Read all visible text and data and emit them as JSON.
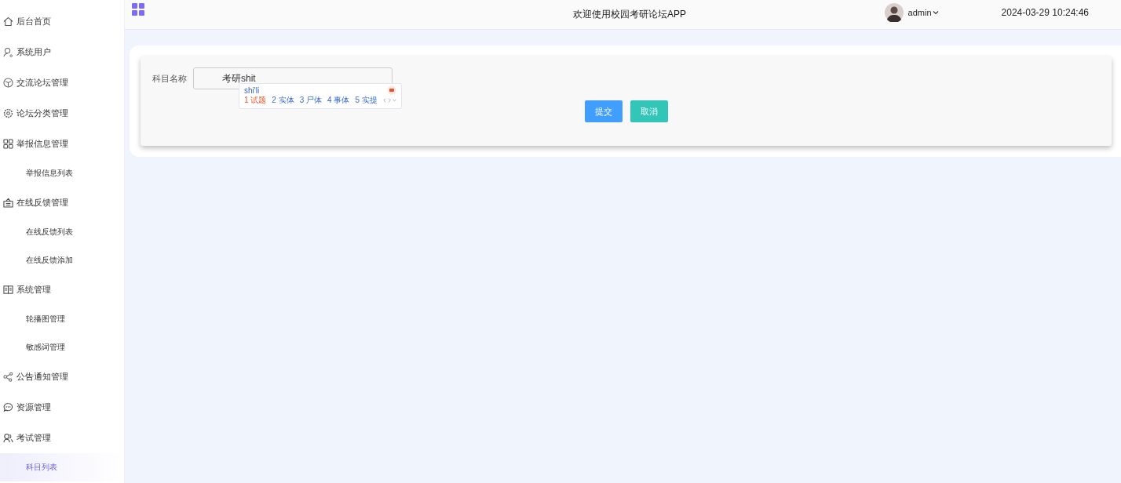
{
  "sidebar": {
    "items": [
      {
        "label": "后台首页",
        "selected": false
      },
      {
        "label": "系统用户",
        "selected": false
      },
      {
        "label": "交流论坛管理",
        "selected": false
      },
      {
        "label": "论坛分类管理",
        "selected": false
      },
      {
        "label": "举报信息管理",
        "selected": false,
        "children": [
          {
            "label": "举报信息列表",
            "selected": false
          }
        ]
      },
      {
        "label": "在线反馈管理",
        "selected": false,
        "children": [
          {
            "label": "在线反馈列表",
            "selected": false
          },
          {
            "label": "在线反馈添加",
            "selected": false
          }
        ]
      },
      {
        "label": "系统管理",
        "selected": false,
        "children": [
          {
            "label": "轮播图管理",
            "selected": false
          },
          {
            "label": "敏感词管理",
            "selected": false
          }
        ]
      },
      {
        "label": "公告通知管理",
        "selected": false
      },
      {
        "label": "资源管理",
        "selected": false
      },
      {
        "label": "考试管理",
        "selected": false,
        "children": [
          {
            "label": "科目列表",
            "selected": true
          }
        ]
      }
    ]
  },
  "header": {
    "title": "欢迎使用校园考研论坛APP",
    "user": "admin",
    "datetime": "2024-03-29 10:24:46"
  },
  "form": {
    "label": "科目名称",
    "value": "考研shit",
    "buttons": [
      {
        "label": "提交",
        "kind": "primary"
      },
      {
        "label": "取消",
        "kind": "cancel"
      }
    ]
  },
  "ime_popup": {
    "composition": "shi'li",
    "candidates": [
      {
        "label": "1 试题",
        "selected": true
      },
      {
        "label": "2 实体",
        "selected": false
      },
      {
        "label": "3 尸体",
        "selected": false
      },
      {
        "label": "4 事体",
        "selected": false
      },
      {
        "label": "5 实提",
        "selected": false
      }
    ]
  }
}
